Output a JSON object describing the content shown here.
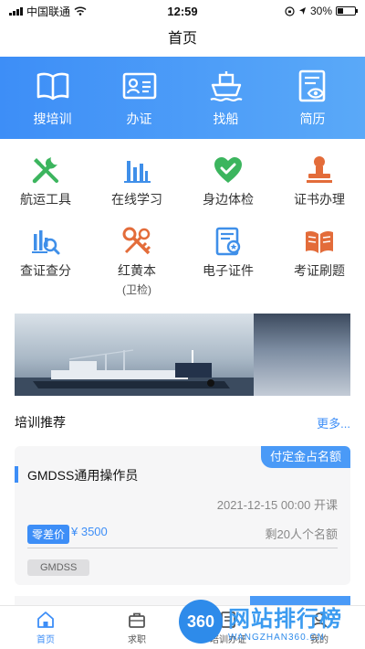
{
  "status_bar": {
    "carrier": "中国联通",
    "time": "12:59",
    "battery": "30%"
  },
  "nav": {
    "title": "首页"
  },
  "hero": [
    {
      "label": "搜培训",
      "icon": "book-icon"
    },
    {
      "label": "办证",
      "icon": "id-card-icon"
    },
    {
      "label": "找船",
      "icon": "ship-icon"
    },
    {
      "label": "简历",
      "icon": "resume-icon"
    }
  ],
  "tools": [
    {
      "label": "航运工具",
      "icon": "tools-icon"
    },
    {
      "label": "在线学习",
      "icon": "bar-chart-icon"
    },
    {
      "label": "身边体检",
      "icon": "health-check-icon"
    },
    {
      "label": "证书办理",
      "icon": "stamp-icon"
    },
    {
      "label": "查证查分",
      "icon": "chart-search-icon"
    },
    {
      "label": "红黄本",
      "sub": "(卫检)",
      "icon": "key-icon"
    },
    {
      "label": "电子证件",
      "icon": "e-certificate-icon"
    },
    {
      "label": "考证刷题",
      "icon": "open-book-icon"
    }
  ],
  "section": {
    "title": "培训推荐",
    "more": "更多..."
  },
  "course": {
    "tag": "付定金占名额",
    "title": "GMDSS通用操作员",
    "time": "2021-12-15 00:00 开课",
    "price_badge": "零差价",
    "price": "¥ 3500",
    "seats": "剩20人个名额",
    "keyword": "GMDSS"
  },
  "tabs": [
    {
      "label": "首页",
      "icon": "home-icon"
    },
    {
      "label": "求职",
      "icon": "briefcase-icon"
    },
    {
      "label": "培训办证",
      "icon": "document-icon"
    },
    {
      "label": "我的",
      "icon": "user-icon"
    }
  ],
  "watermark": {
    "logo": "360",
    "main": "网站排行榜",
    "sub": "WANGZHAN360.CN"
  },
  "colors": {
    "primary": "#3d8ef7",
    "tool_green": "#3cb55e",
    "tool_blue": "#3f8fe9",
    "tool_orange": "#e36c3a"
  }
}
